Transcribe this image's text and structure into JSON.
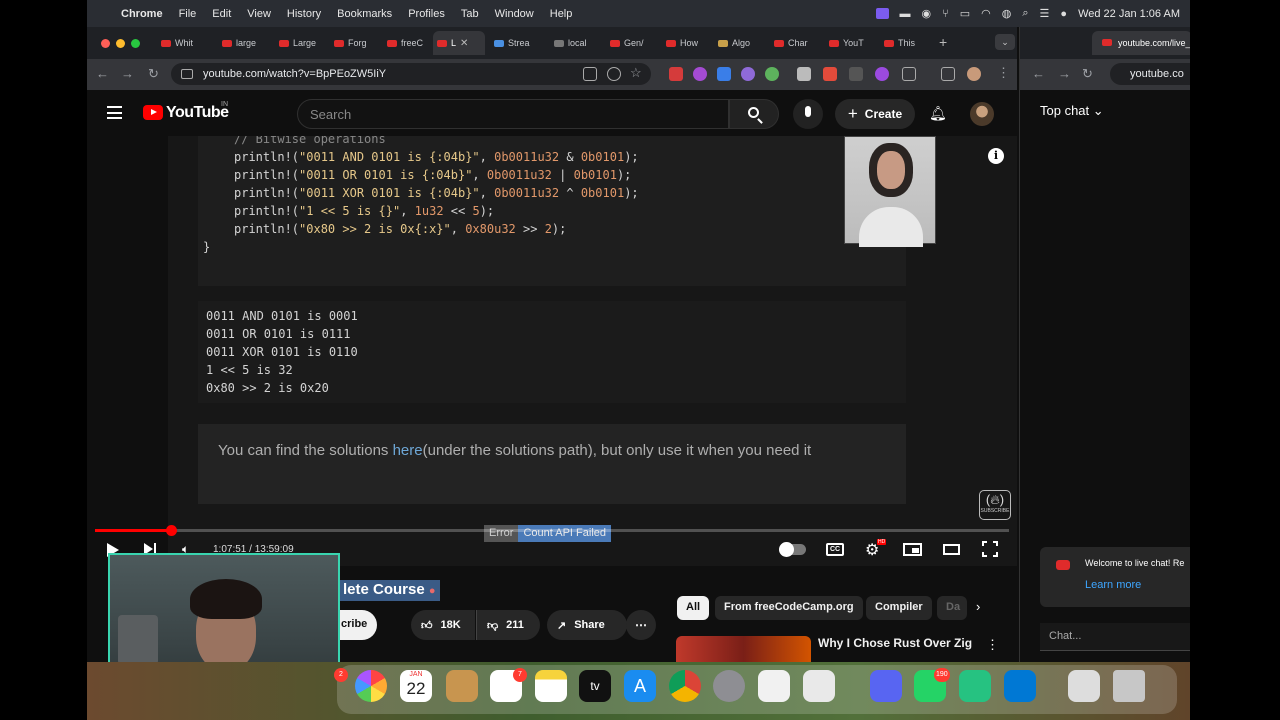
{
  "menubar": {
    "items": [
      "Chrome",
      "File",
      "Edit",
      "View",
      "History",
      "Bookmarks",
      "Profiles",
      "Tab",
      "Window",
      "Help"
    ],
    "datetime": "Wed 22 Jan  1:06 AM"
  },
  "tabs": [
    {
      "label": "Whit"
    },
    {
      "label": "large"
    },
    {
      "label": "Large"
    },
    {
      "label": "Forg"
    },
    {
      "label": "freeC"
    },
    {
      "label": "L"
    },
    {
      "label": "Strea"
    },
    {
      "label": "local"
    },
    {
      "label": "Gen/"
    },
    {
      "label": "How"
    },
    {
      "label": "Algo"
    },
    {
      "label": "Char"
    },
    {
      "label": "YouT"
    },
    {
      "label": "This"
    }
  ],
  "toolbar": {
    "url": "youtube.com/watch?v=BpPEoZW5IiY"
  },
  "chatwindow": {
    "url": "youtube.com/live_c",
    "tab_label": "youtube.com/live_c",
    "url_short": "youtube.co",
    "top_chat": "Top chat",
    "welcome": "Welcome to live chat! Re",
    "learn_more": "Learn more",
    "chat_placeholder": "Chat..."
  },
  "ytheader": {
    "logo_text": "YouTube",
    "country": "IN",
    "search_placeholder": "Search",
    "create_label": "Create"
  },
  "video": {
    "code_lines": [
      {
        "parts": [
          {
            "t": "// Bitwise operations",
            "c": "c"
          }
        ]
      },
      {
        "parts": [
          {
            "t": "println!(",
            "c": ""
          },
          {
            "t": "\"0011 AND 0101 is {:04b}\"",
            "c": "s"
          },
          {
            "t": ", ",
            "c": ""
          },
          {
            "t": "0b0011u32",
            "c": "n"
          },
          {
            "t": " & ",
            "c": ""
          },
          {
            "t": "0b0101",
            "c": "n"
          },
          {
            "t": ");",
            "c": ""
          }
        ]
      },
      {
        "parts": [
          {
            "t": "println!(",
            "c": ""
          },
          {
            "t": "\"0011 OR 0101 is {:04b}\"",
            "c": "s"
          },
          {
            "t": ", ",
            "c": ""
          },
          {
            "t": "0b0011u32",
            "c": "n"
          },
          {
            "t": " | ",
            "c": ""
          },
          {
            "t": "0b0101",
            "c": "n"
          },
          {
            "t": ");",
            "c": ""
          }
        ]
      },
      {
        "parts": [
          {
            "t": "println!(",
            "c": ""
          },
          {
            "t": "\"0011 XOR 0101 is {:04b}\"",
            "c": "s"
          },
          {
            "t": ", ",
            "c": ""
          },
          {
            "t": "0b0011u32",
            "c": "n"
          },
          {
            "t": " ^ ",
            "c": ""
          },
          {
            "t": "0b0101",
            "c": "n"
          },
          {
            "t": ");",
            "c": ""
          }
        ]
      },
      {
        "parts": [
          {
            "t": "println!(",
            "c": ""
          },
          {
            "t": "\"1 << 5 is {}\"",
            "c": "s"
          },
          {
            "t": ", ",
            "c": ""
          },
          {
            "t": "1u32",
            "c": "n"
          },
          {
            "t": " << ",
            "c": ""
          },
          {
            "t": "5",
            "c": "n"
          },
          {
            "t": ");",
            "c": ""
          }
        ]
      },
      {
        "parts": [
          {
            "t": "println!(",
            "c": ""
          },
          {
            "t": "\"0x80 >> 2 is 0x{:x}\"",
            "c": "s"
          },
          {
            "t": ", ",
            "c": ""
          },
          {
            "t": "0x80u32",
            "c": "n"
          },
          {
            "t": " >> ",
            "c": ""
          },
          {
            "t": "2",
            "c": "n"
          },
          {
            "t": ");",
            "c": ""
          }
        ]
      }
    ],
    "closing_brace": "}",
    "output": "0011 AND 0101 is 0001\n0011 OR 0101 is 0111\n0011 XOR 0101 is 0110\n1 << 5 is 32\n0x80 >> 2 is 0x20",
    "note_before": "You can find the solutions ",
    "note_link": "here",
    "note_after": "(under the solutions path), but only use it when you need it",
    "fcc_sub": "SUBSCRIBE"
  },
  "controls": {
    "error_label": "Error",
    "error_text": "Count API Failed",
    "time": "1:07:51 / 13:59:09",
    "progress": 0.084,
    "cc": "CC",
    "hd": "HD"
  },
  "below": {
    "title_fragment": "lete Course",
    "subscribe": "cribe",
    "likes": "18K",
    "dislikes": "211",
    "share": "Share",
    "chips": [
      "All",
      "From freeCodeCamp.org",
      "Compiler",
      "Da"
    ],
    "rec_title": "Why I Chose Rust Over Zig"
  },
  "dock": {
    "calendar_month": "JAN",
    "calendar_day": "22",
    "reminders_badge": "7",
    "whatsapp_badge": "190",
    "left_badge": "2",
    "tv_label": "tv"
  }
}
